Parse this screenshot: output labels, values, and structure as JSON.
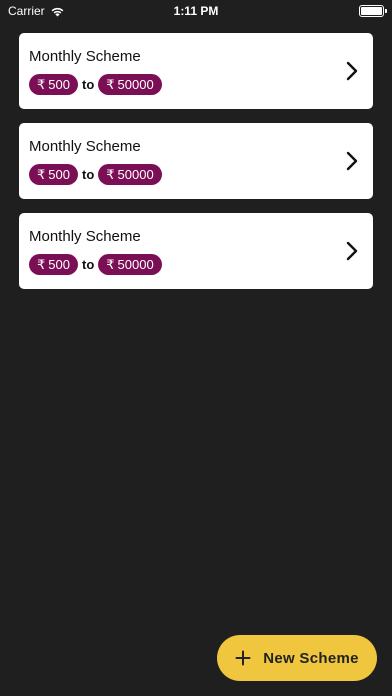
{
  "status_bar": {
    "carrier": "Carrier",
    "time": "1:11 PM"
  },
  "schemes": [
    {
      "title": "Monthly Scheme",
      "currency": "₹",
      "min": "500",
      "connector": "to",
      "max": "50000"
    },
    {
      "title": "Monthly Scheme",
      "currency": "₹",
      "min": "500",
      "connector": "to",
      "max": "50000"
    },
    {
      "title": "Monthly Scheme",
      "currency": "₹",
      "min": "500",
      "connector": "to",
      "max": "50000"
    }
  ],
  "fab": {
    "label": "New Scheme",
    "icon": "plus-icon"
  },
  "colors": {
    "background": "#1f1f1f",
    "card": "#ffffff",
    "pill": "#7b0f55",
    "fab": "#f0c63e"
  }
}
